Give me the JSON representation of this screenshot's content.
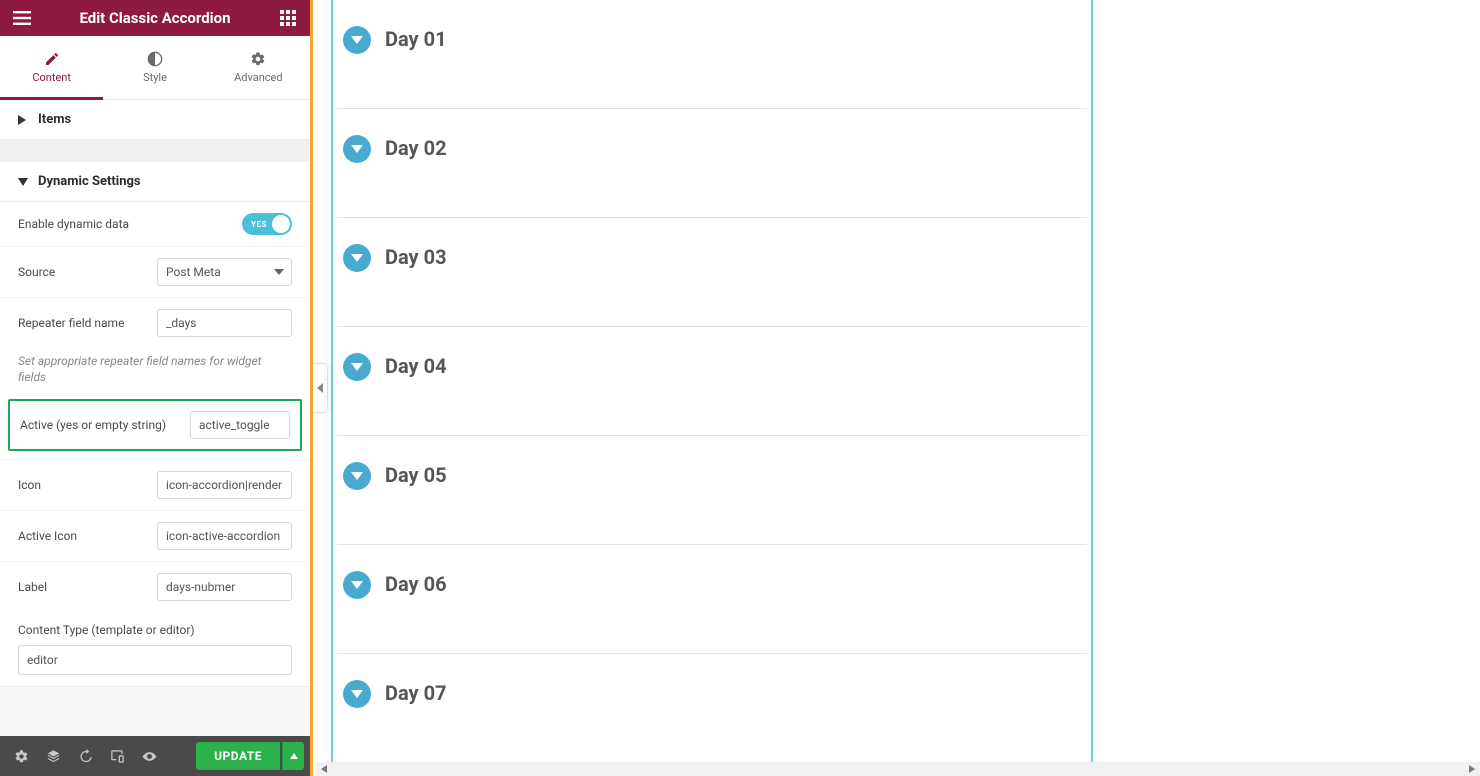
{
  "header": {
    "title": "Edit Classic Accordion"
  },
  "tabs": {
    "content": "Content",
    "style": "Style",
    "advanced": "Advanced"
  },
  "sections": {
    "items": "Items",
    "dynamic_settings": "Dynamic Settings"
  },
  "fields": {
    "enable_dynamic_data": {
      "label": "Enable dynamic data",
      "value_text": "YES"
    },
    "source": {
      "label": "Source",
      "value": "Post Meta"
    },
    "repeater_field_name": {
      "label": "Repeater field name",
      "value": "_days"
    },
    "help_text": "Set appropriate repeater field names for widget fields",
    "active": {
      "label": "Active (yes or empty string)",
      "value": "active_toggle"
    },
    "icon_field": {
      "label": "Icon",
      "value": "icon-accordion|render"
    },
    "active_icon": {
      "label": "Active Icon",
      "value": "icon-active-accordion"
    },
    "label_field": {
      "label": "Label",
      "value": "days-nubmer"
    },
    "content_type": {
      "label": "Content Type (template or editor)",
      "value": "editor"
    }
  },
  "footer": {
    "update": "UPDATE"
  },
  "accordion": {
    "items": [
      {
        "title": "Day 01"
      },
      {
        "title": "Day 02"
      },
      {
        "title": "Day 03"
      },
      {
        "title": "Day 04"
      },
      {
        "title": "Day 05"
      },
      {
        "title": "Day 06"
      },
      {
        "title": "Day 07"
      }
    ]
  }
}
